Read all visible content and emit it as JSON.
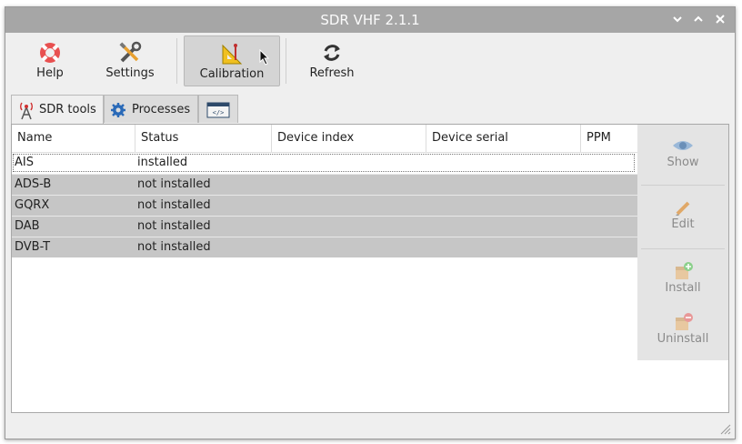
{
  "window": {
    "title": "SDR VHF 2.1.1"
  },
  "toolbar": {
    "help": "Help",
    "settings": "Settings",
    "calibration": "Calibration",
    "refresh": "Refresh"
  },
  "tabs": [
    {
      "label": "SDR tools",
      "icon": "antenna-icon"
    },
    {
      "label": "Processes",
      "icon": "gear-icon"
    },
    {
      "label": "",
      "icon": "terminal-code-icon"
    }
  ],
  "table": {
    "columns": [
      "Name",
      "Status",
      "Device index",
      "Device serial",
      "PPM"
    ],
    "rows": [
      {
        "name": "AIS",
        "status": "installed"
      },
      {
        "name": "ADS-B",
        "status": "not installed"
      },
      {
        "name": "GQRX",
        "status": "not installed"
      },
      {
        "name": "DAB",
        "status": "not installed"
      },
      {
        "name": "DVB-T",
        "status": "not installed"
      }
    ]
  },
  "side": {
    "show": "Show",
    "edit": "Edit",
    "install": "Install",
    "uninstall": "Uninstall"
  },
  "colors": {
    "titlebar": "#a6a6a6",
    "selected_row": "#c6c6c6",
    "accent": "#2a6ab8"
  }
}
